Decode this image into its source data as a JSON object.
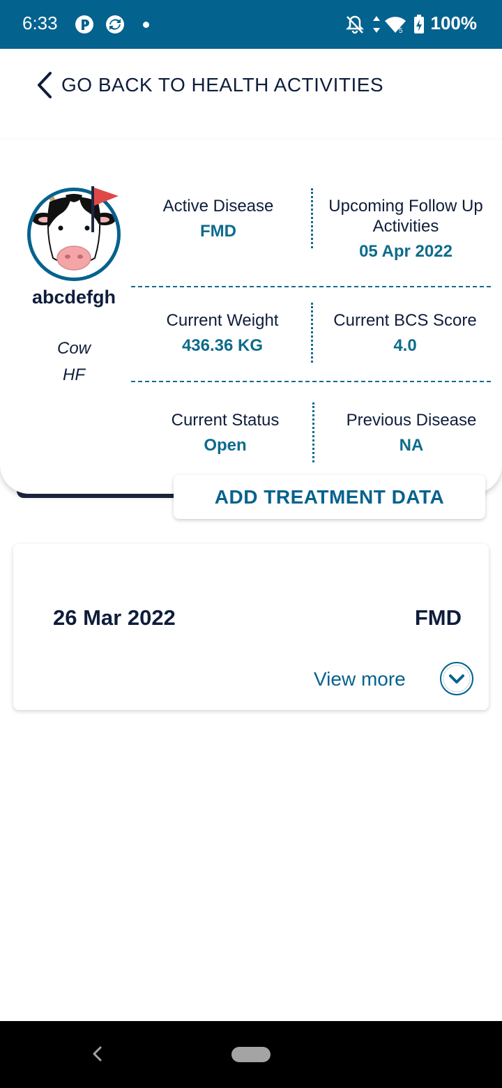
{
  "status_bar": {
    "time": "6:33",
    "battery": "100%",
    "icons": [
      "p-app-icon",
      "sync-icon",
      "notification-dot",
      "bell-off-icon",
      "data-arrows-icon",
      "wifi-icon",
      "battery-charging-icon"
    ]
  },
  "header": {
    "back_label": "GO BACK TO HEALTH ACTIVITIES"
  },
  "animal": {
    "name": "abcdefgh",
    "type": "Cow",
    "breed": "HF",
    "avatar_icon": "cow-face-icon",
    "flag_icon": "red-flag-icon"
  },
  "stats": {
    "active_disease": {
      "label": "Active Disease",
      "value": "FMD"
    },
    "upcoming_follow_up": {
      "label": "Upcoming Follow Up Activities",
      "value": "05 Apr 2022"
    },
    "current_weight": {
      "label": "Current Weight",
      "value": "436.36 KG"
    },
    "current_bcs": {
      "label": "Current BCS Score",
      "value": "4.0"
    },
    "current_status": {
      "label": "Current Status",
      "value": "Open"
    },
    "previous_disease": {
      "label": "Previous Disease",
      "value": "NA"
    }
  },
  "actions": {
    "add_treatment": "ADD TREATMENT DATA"
  },
  "records": [
    {
      "date": "26 Mar 2022",
      "disease": "FMD",
      "view_more": "View more"
    }
  ],
  "colors": {
    "primary": "#04628e",
    "accent_teal": "#0d6b8c",
    "text_dark": "#0f1d3b",
    "flag_red": "#e04848"
  }
}
